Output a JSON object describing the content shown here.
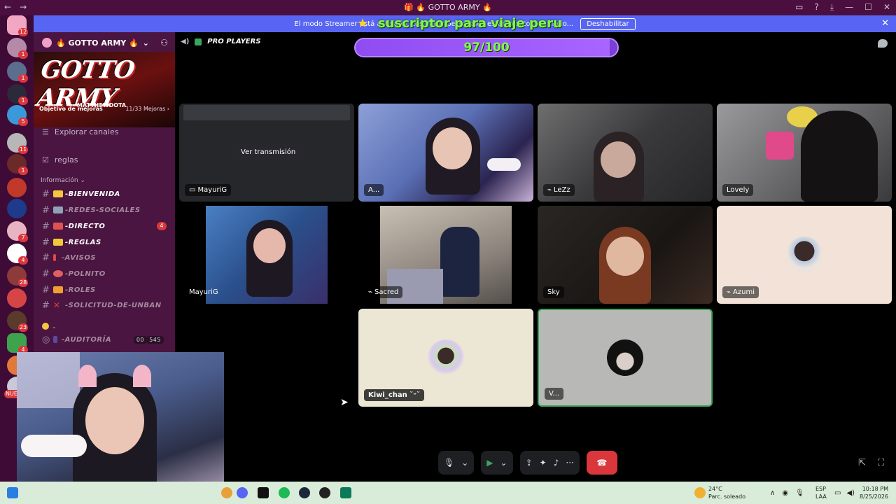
{
  "window": {
    "title": "🎁 🔥 GOTTO ARMY 🔥",
    "back": "←",
    "forward": "→",
    "controls": [
      "▭",
      "?",
      "⤓",
      "—",
      "☐",
      "✕"
    ]
  },
  "notice": {
    "text": "El modo Streamer está activado. Los datos personales están ocultos. El modo...",
    "button": "Deshabilitar",
    "close": "✕"
  },
  "stream_goal": {
    "title": "suscriptor para viaje peru",
    "current": 97,
    "target": 100,
    "count_label": "97/100"
  },
  "server_rail": {
    "badges": [
      "12",
      "1",
      "1",
      "1",
      "5",
      "11",
      "1",
      "7",
      "4",
      "28",
      "23",
      "4",
      "NUEVO"
    ]
  },
  "server": {
    "name": "🔥 GOTTO ARMY 🔥",
    "chevron": "⌄",
    "banner_title": "GOTTO ARMY",
    "banner_subtitle": "MATTHEWDOTA",
    "boost_label": "Objetivo de mejoras",
    "boost_progress": "11/33 Mejoras",
    "boost_chevron": "›"
  },
  "sidebar": {
    "explore_label": "Explorar canales",
    "rules_label": "reglas",
    "category_label": "Información",
    "category_chevron": "⌄",
    "channels": [
      {
        "name": "-BIENVENIDA",
        "emoji_color": "#f5c542",
        "bold": true
      },
      {
        "name": "-REDES-SOCIALES",
        "emoji_color": "#8fa3b8",
        "bold": false
      },
      {
        "name": "-DIRECTO",
        "emoji_color": "#e05252",
        "bold": true,
        "mentions": "4"
      },
      {
        "name": "-REGLAS",
        "emoji_color": "#f0c93a",
        "bold": true
      },
      {
        "name": "-AVISOS",
        "emoji_color": "#e04848",
        "bold": false
      },
      {
        "name": "-POLNITO",
        "emoji_color": "#e06060",
        "bold": false
      },
      {
        "name": "-ROLES",
        "emoji_color": "#f0a030",
        "bold": false
      },
      {
        "name": "-SOLICITUD-DE-UNBAN",
        "emoji_color": "#e03a3a",
        "bold": false
      }
    ],
    "voice_channel": {
      "name": "-AUDITORÍA",
      "users": "00",
      "count": "545"
    }
  },
  "call": {
    "channel_name": "PRO PLAYERS",
    "watch_button": "Ver transmisión",
    "participants": [
      {
        "name": "MayuriG",
        "kind": "stream"
      },
      {
        "name": "A...",
        "kind": "camera"
      },
      {
        "name": "LeZz",
        "kind": "camera",
        "muted": true
      },
      {
        "name": "Lovely",
        "kind": "camera"
      },
      {
        "name": "MayuriG",
        "kind": "camera"
      },
      {
        "name": "Sacred",
        "kind": "camera",
        "muted": true
      },
      {
        "name": "Sky",
        "kind": "camera"
      },
      {
        "name": "Azumi",
        "kind": "avatar",
        "muted": true
      },
      {
        "name": "Kiwi_chan ˘ᵕ˘",
        "kind": "avatar"
      },
      {
        "name": "V...",
        "kind": "avatar",
        "speaking": true
      }
    ]
  },
  "controls": {
    "mic_icon": "🎙",
    "camera_icon": "▶",
    "chevron": "⌄",
    "share_icon": "⇪",
    "activities_icon": "✦",
    "soundboard_icon": "♪",
    "more_icon": "···",
    "end_call_icon": "☎",
    "popout_icon": "⇱",
    "fullscreen_icon": "⛶"
  },
  "taskbar": {
    "weather_temp": "24°C",
    "weather_desc": "Parc. soleado",
    "lang_top": "ESP",
    "lang_bottom": "LAA",
    "time": "10:18 PM",
    "date": "8/25/2026",
    "tray_chevron": "∧"
  },
  "colors": {
    "accent": "#5865f2",
    "titlebar": "#4b0f3f",
    "sidebar": "#4a1540",
    "danger": "#da373c",
    "speaking": "#3ba55d",
    "goal_text": "#7dff4a",
    "goal_bar": "#7b3fd6"
  }
}
